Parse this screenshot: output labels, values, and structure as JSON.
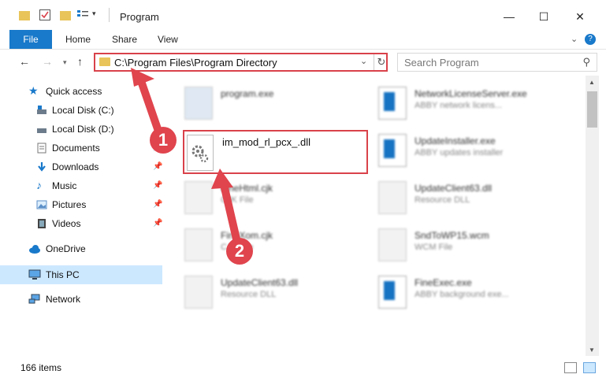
{
  "window": {
    "title": "Program",
    "minimize": "—",
    "maximize": "☐",
    "close": "✕"
  },
  "ribbon": {
    "file": "File",
    "home": "Home",
    "share": "Share",
    "view": "View",
    "help": "?"
  },
  "nav": {
    "address": "C:\\Program Files\\Program Directory",
    "search_placeholder": "Search Program"
  },
  "sidebar": {
    "quick_access": "Quick access",
    "items": [
      {
        "label": "Local Disk (C:)",
        "icon": "drive-icon",
        "pinned": false
      },
      {
        "label": "Local Disk (D:)",
        "icon": "drive-icon",
        "pinned": false
      },
      {
        "label": "Documents",
        "icon": "documents-icon",
        "pinned": true
      },
      {
        "label": "Downloads",
        "icon": "downloads-icon",
        "pinned": true
      },
      {
        "label": "Music",
        "icon": "music-icon",
        "pinned": true
      },
      {
        "label": "Pictures",
        "icon": "pictures-icon",
        "pinned": true
      },
      {
        "label": "Videos",
        "icon": "videos-icon",
        "pinned": true
      }
    ],
    "onedrive": "OneDrive",
    "thispc": "This PC",
    "network": "Network"
  },
  "files": [
    {
      "name": "program.exe",
      "desc": ""
    },
    {
      "name": "NetworkLicenseServer.exe",
      "desc": "ABBY network licens..."
    },
    {
      "name": "UpdateInstaller.exe",
      "desc": "ABBY updates installer"
    },
    {
      "name": "FineHtml.cjk",
      "desc": "CJK File"
    },
    {
      "name": "UpdateClient63.dll",
      "desc": "Resource DLL"
    },
    {
      "name": "FineXom.cjk",
      "desc": "CJK File"
    },
    {
      "name": "SndToWP15.wcm",
      "desc": "WCM File"
    },
    {
      "name": "UpdateClient63.dll",
      "desc": "Resource DLL"
    },
    {
      "name": "FineExec.exe",
      "desc": "ABBY background exe..."
    }
  ],
  "highlighted_file": "im_mod_rl_pcx_.dll",
  "annotations": {
    "step1": "1",
    "step2": "2"
  },
  "status": {
    "count": "166 items"
  },
  "colors": {
    "accent": "#1979ca",
    "highlight": "#d9424a",
    "selected": "#cce8ff"
  }
}
